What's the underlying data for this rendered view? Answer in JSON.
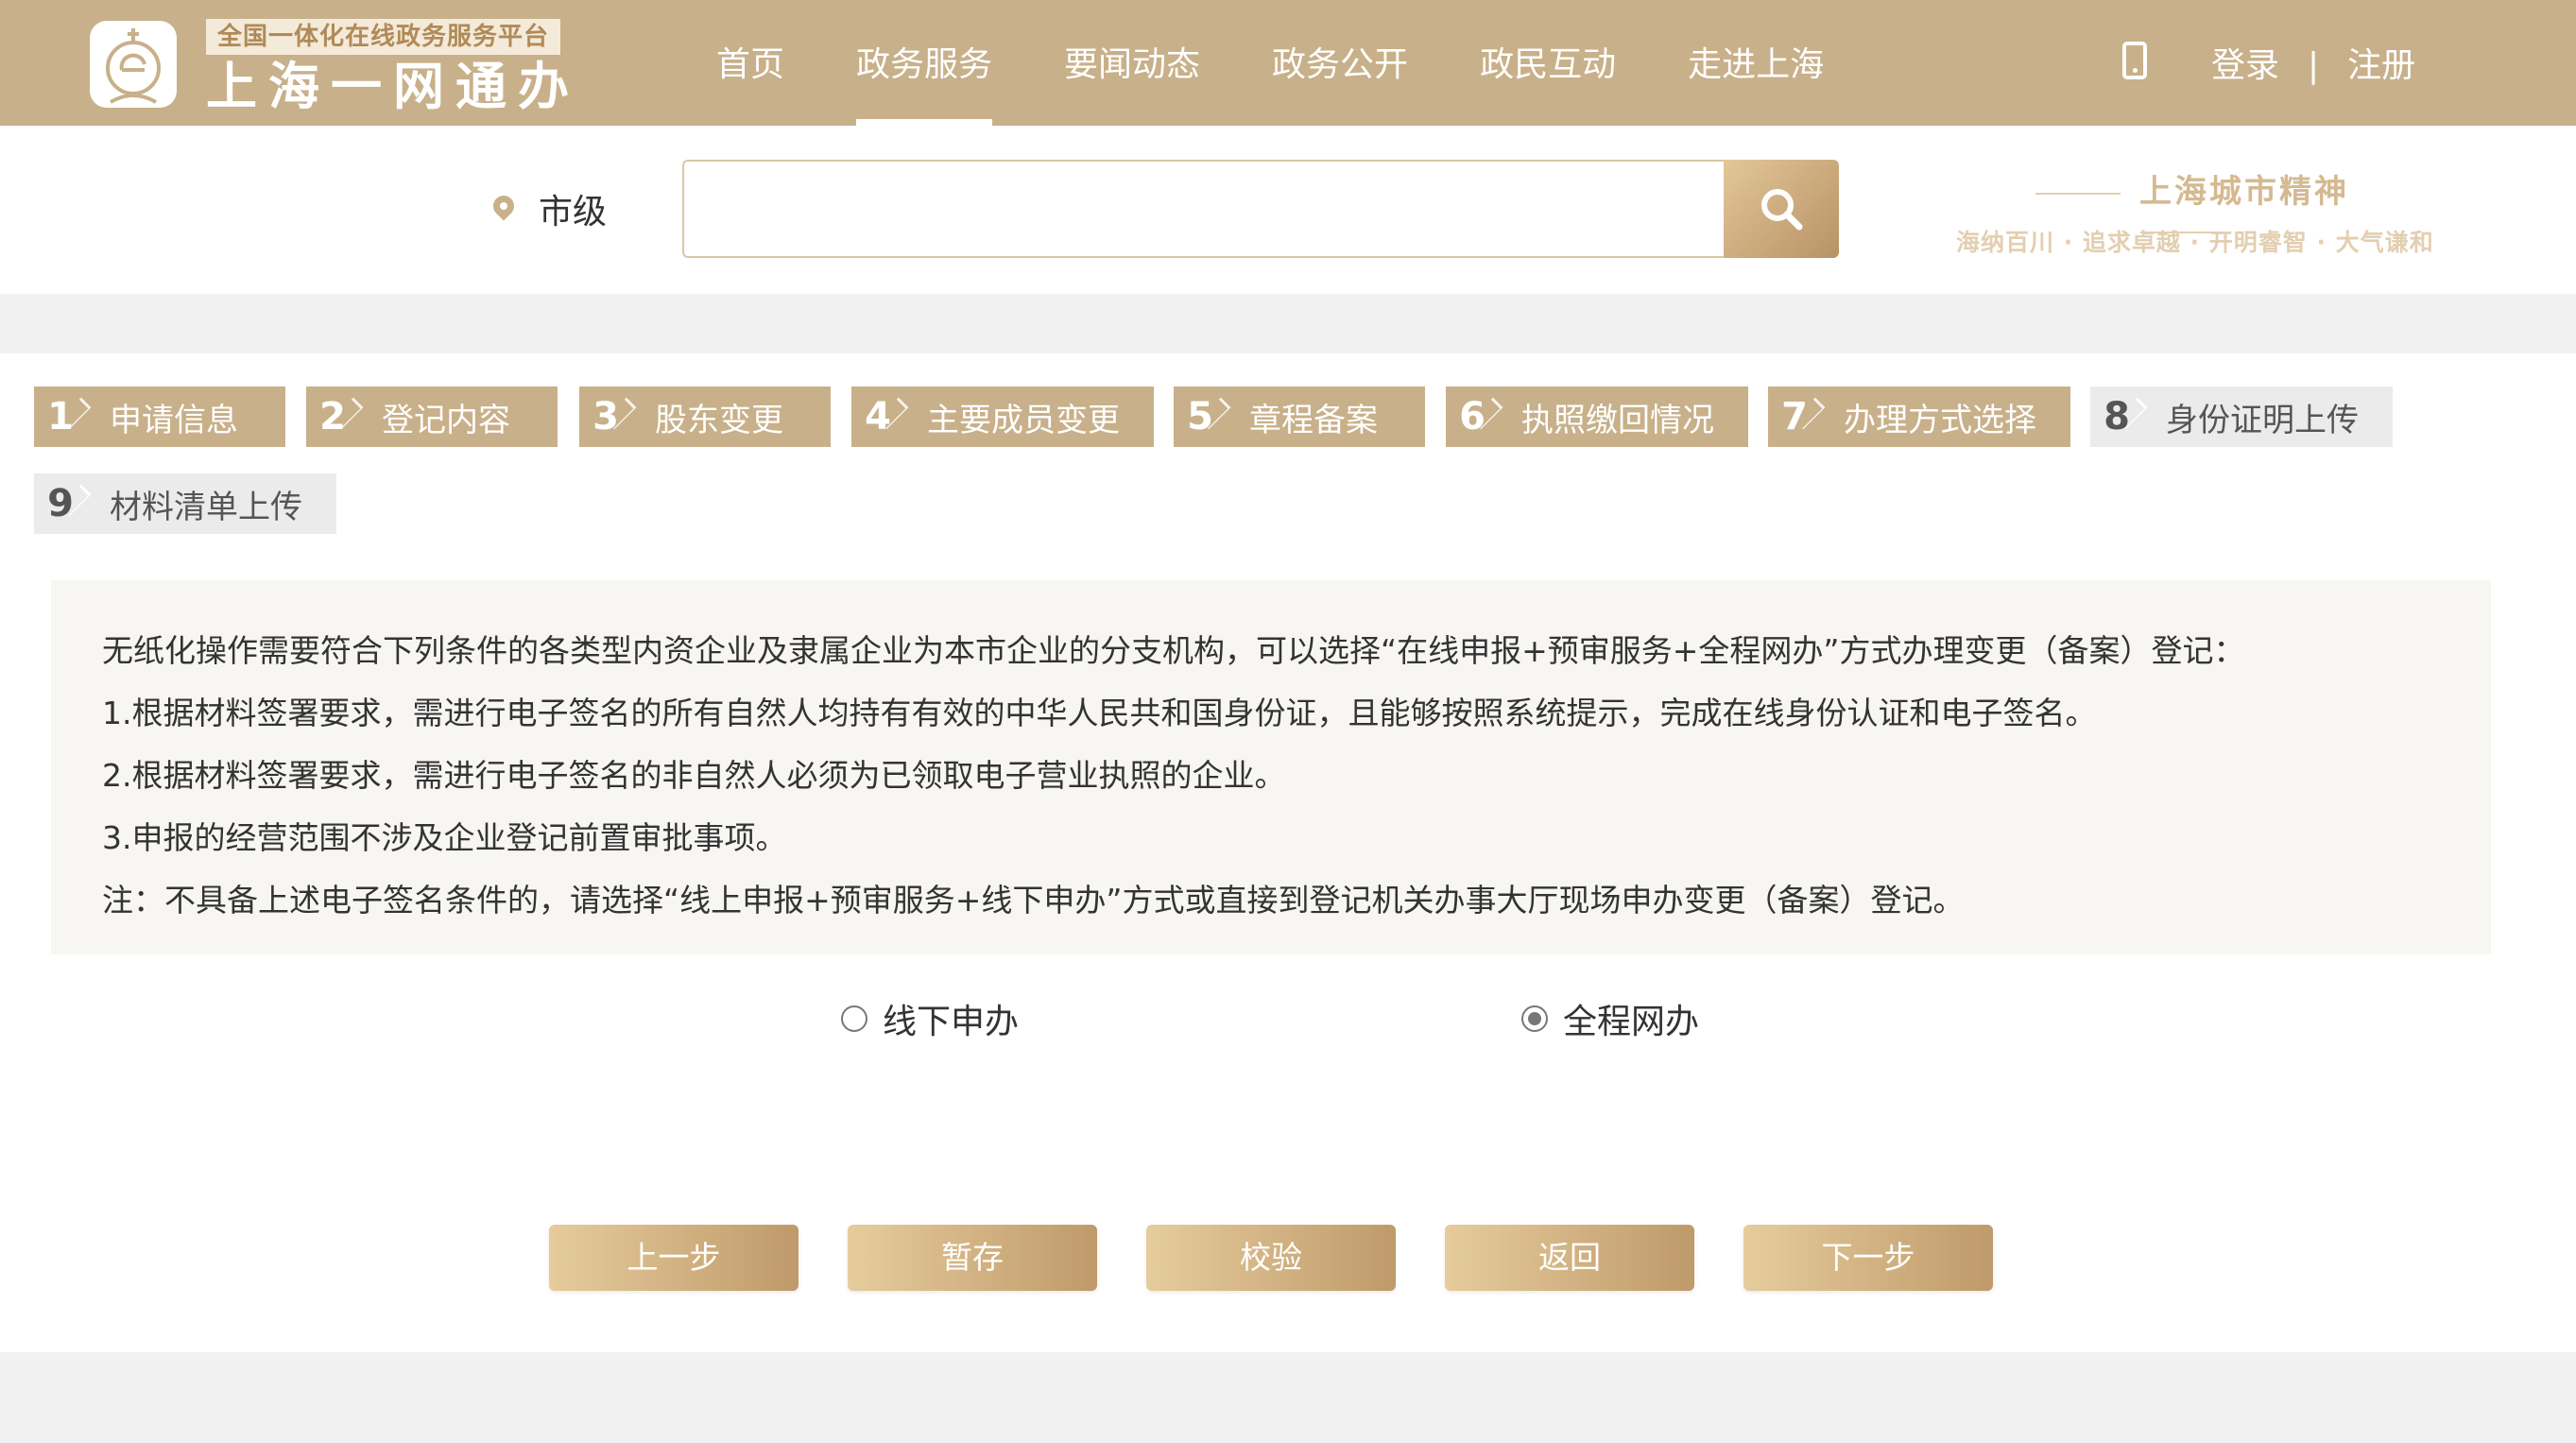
{
  "header": {
    "logo_subtitle": "全国一体化在线政务服务平台",
    "logo_title": "上海一网通办",
    "nav": [
      "首页",
      "政务服务",
      "要闻动态",
      "政务公开",
      "政民互动",
      "走进上海"
    ],
    "active_nav": "政务服务",
    "login": "登录",
    "separator": "|",
    "register": "注册"
  },
  "search": {
    "location": "市级",
    "placeholder": "",
    "spirit_title": "上海城市精神",
    "spirit_motto": "海纳百川 · 追求卓越 · 开明睿智 · 大气谦和"
  },
  "steps": [
    {
      "num": "1",
      "label": "申请信息",
      "state": "done"
    },
    {
      "num": "2",
      "label": "登记内容",
      "state": "done"
    },
    {
      "num": "3",
      "label": "股东变更",
      "state": "done"
    },
    {
      "num": "4",
      "label": "主要成员变更",
      "state": "done"
    },
    {
      "num": "5",
      "label": "章程备案",
      "state": "done"
    },
    {
      "num": "6",
      "label": "执照缴回情况",
      "state": "done"
    },
    {
      "num": "7",
      "label": "办理方式选择",
      "state": "current"
    },
    {
      "num": "8",
      "label": "身份证明上传",
      "state": "pending"
    },
    {
      "num": "9",
      "label": "材料清单上传",
      "state": "pending"
    }
  ],
  "notice": [
    "无纸化操作需要符合下列条件的各类型内资企业及隶属企业为本市企业的分支机构，可以选择“在线申报+预审服务+全程网办”方式办理变更（备案）登记：",
    "1.根据材料签署要求，需进行电子签名的所有自然人均持有有效的中华人民共和国身份证，且能够按照系统提示，完成在线身份认证和电子签名。",
    "2.根据材料签署要求，需进行电子签名的非自然人必须为已领取电子营业执照的企业。",
    "3.申报的经营范围不涉及企业登记前置审批事项。",
    "注：不具备上述电子签名条件的，请选择“线上申报+预审服务+线下申办”方式或直接到登记机关办事大厅现场申办变更（备案）登记。"
  ],
  "options": {
    "offline": "线下申办",
    "online": "全程网办",
    "selected": "全程网办"
  },
  "buttons": {
    "prev": "上一步",
    "save": "暂存",
    "verify": "校验",
    "back": "返回",
    "next": "下一步"
  },
  "colors": {
    "brand": "#c8b08a",
    "pending_step": "#ebebeb"
  }
}
